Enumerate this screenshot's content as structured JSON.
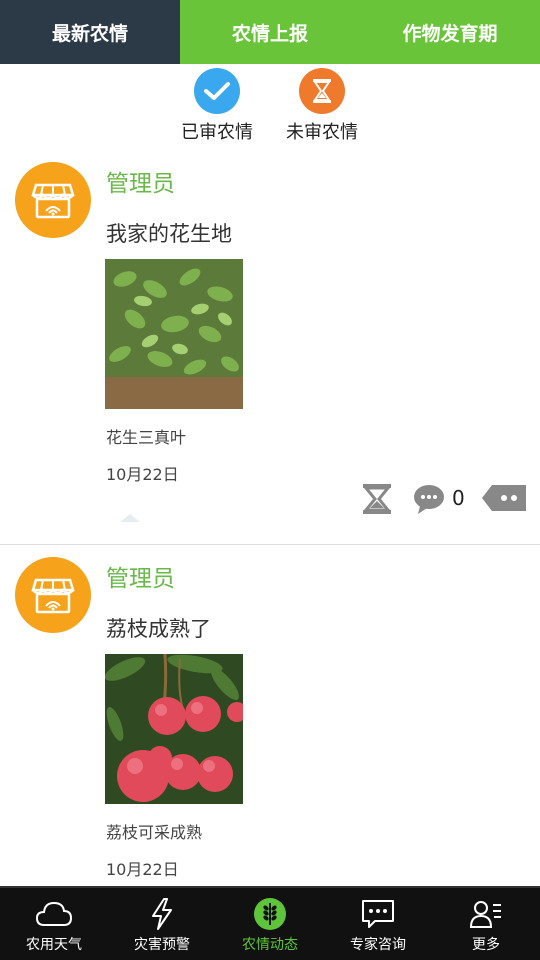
{
  "tabs": [
    {
      "label": "最新农情"
    },
    {
      "label": "农情上报"
    },
    {
      "label": "作物发育期"
    }
  ],
  "filters": [
    {
      "label": "已审农情",
      "icon": "check-icon",
      "color": "#3aa8ef"
    },
    {
      "label": "未审农情",
      "icon": "hourglass-icon",
      "color": "#f07a2c"
    }
  ],
  "posts": [
    {
      "author": "管理员",
      "title": "我家的花生地",
      "photo": "peanut-field-photo",
      "caption": "花生三真叶",
      "date": "10月22日",
      "comment_count": "0"
    },
    {
      "author": "管理员",
      "title": "荔枝成熟了",
      "photo": "lychee-photo",
      "caption": "荔枝可采成熟",
      "date": "10月22日"
    }
  ],
  "bottom_nav": [
    {
      "label": "农用天气",
      "icon": "cloud-icon"
    },
    {
      "label": "灾害预警",
      "icon": "lightning-icon"
    },
    {
      "label": "农情动态",
      "icon": "wheat-icon",
      "active": true
    },
    {
      "label": "专家咨询",
      "icon": "chat-bubble-icon"
    },
    {
      "label": "更多",
      "icon": "person-menu-icon"
    }
  ],
  "colors": {
    "active_tab": "#2c3a48",
    "green": "#6ac43a",
    "author_green": "#6ab84a",
    "avatar_orange": "#f6a21a",
    "nav_bg": "#111111"
  }
}
